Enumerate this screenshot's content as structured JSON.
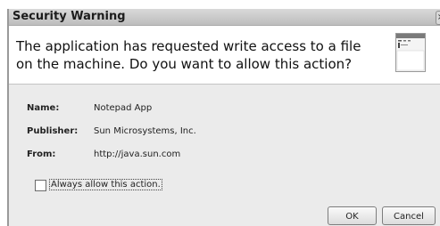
{
  "dialog": {
    "title": "Security Warning",
    "close_glyph": "×"
  },
  "header": {
    "message": "The application has requested write access to a file on the machine.  Do you want to allow this action?",
    "icon": "application-window-icon"
  },
  "details": [
    {
      "label": "Name:",
      "value": "Notepad App"
    },
    {
      "label": "Publisher:",
      "value": "Sun Microsystems, Inc."
    },
    {
      "label": "From:",
      "value": "http://java.sun.com"
    }
  ],
  "options": {
    "always_allow_label": "Always allow this action.",
    "always_allow_checked": false
  },
  "buttons": {
    "ok_label": "OK",
    "cancel_label": "Cancel"
  }
}
